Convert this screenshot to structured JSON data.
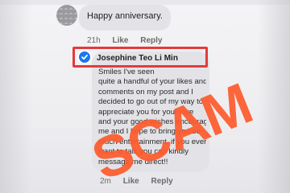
{
  "comments": [
    {
      "text": "Happy anniversary.",
      "time": "21h",
      "like_label": "Like",
      "reply_label": "Reply"
    },
    {
      "author": "Josephine Teo Li Min",
      "verified": true,
      "message_lines": [
        "Smiles I've seen",
        "quite a handful of your likes and",
        "comments on my post and I",
        "decided to go out of my way to",
        "appreciate you for your love",
        "and your good wishes encourages",
        "me and I hope to bring you so",
        "much entertainment, if you ever",
        "want to talk you can kindly",
        "message me direct!!"
      ],
      "time": "2m",
      "like_label": "Like",
      "reply_label": "Reply"
    }
  ],
  "overlay": {
    "stamp_text": "SCAM",
    "stamp_color": "#ff5a2c",
    "highlight_color": "#e23b3b"
  },
  "icons": {
    "verified": "verified-badge-icon"
  }
}
